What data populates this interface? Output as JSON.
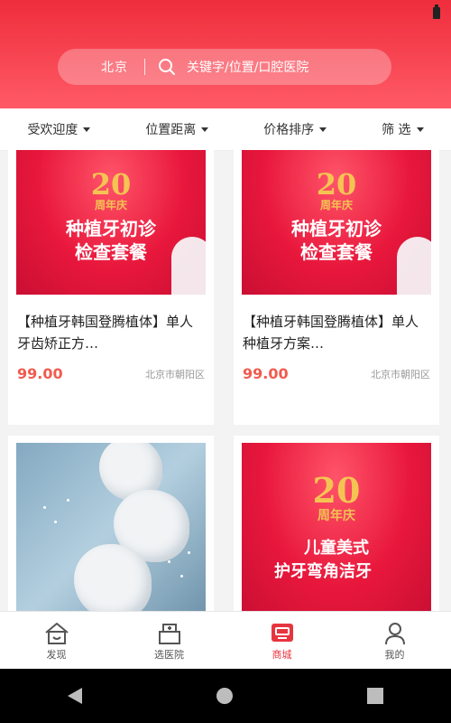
{
  "header": {
    "city": "北京",
    "search_placeholder": "关键字/位置/口腔医院"
  },
  "filters": [
    {
      "label": "受欢迎度"
    },
    {
      "label": "位置距离"
    },
    {
      "label": "价格排序"
    },
    {
      "label": "筛 选"
    }
  ],
  "products": [
    {
      "image_text": {
        "anniversary": "20",
        "anniversary_sub": "周年庆",
        "line1": "种植牙初诊",
        "line2": "检查套餐"
      },
      "title": "【种植牙韩国登腾植体】单人牙齿矫正方…",
      "price": "99.00",
      "location": "北京市朝阳区"
    },
    {
      "image_text": {
        "anniversary": "20",
        "anniversary_sub": "周年庆",
        "line1": "种植牙初诊",
        "line2": "检查套餐"
      },
      "title": "【种植牙韩国登腾植体】单人种植牙方案…",
      "price": "99.00",
      "location": "北京市朝阳区"
    },
    {
      "image_text": {},
      "title": "",
      "price": "",
      "location": ""
    },
    {
      "image_text": {
        "anniversary": "20",
        "anniversary_sub": "周年庆",
        "line1": "儿童美式",
        "line2": "护牙弯角洁牙"
      },
      "title": "",
      "price": "",
      "location": ""
    }
  ],
  "bottom_nav": [
    {
      "label": "发现",
      "icon": "home-icon",
      "active": false
    },
    {
      "label": "选医院",
      "icon": "hospital-icon",
      "active": false
    },
    {
      "label": "商城",
      "icon": "mall-icon",
      "active": true
    },
    {
      "label": "我的",
      "icon": "user-icon",
      "active": false
    }
  ],
  "colors": {
    "brand": "#ef2d3c",
    "price": "#f15b4e",
    "active_nav": "#e7353f"
  }
}
